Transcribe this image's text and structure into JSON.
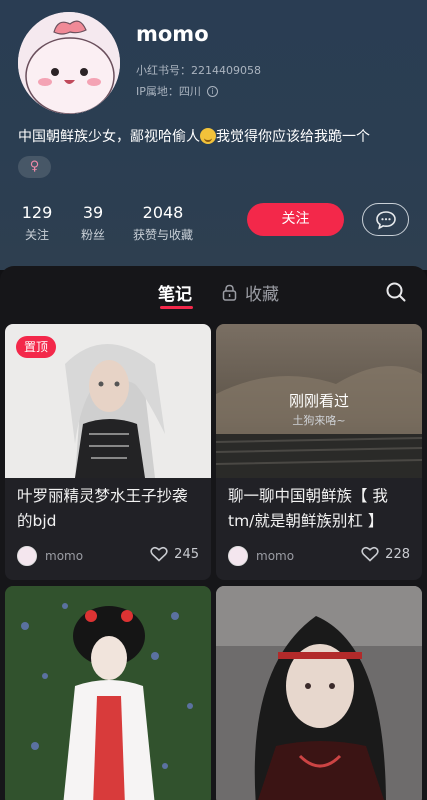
{
  "profile": {
    "nickname": "momo",
    "red_id": "小红书号：2214409058",
    "ip": "IP属地：四川",
    "bio_before": "中国朝鲜族少女，鄙视哈偷人",
    "bio_after": "我觉得你应该给我跪一个",
    "gender_symbol": "♀"
  },
  "stats": [
    {
      "value": "129",
      "label": "关注"
    },
    {
      "value": "39",
      "label": "粉丝"
    },
    {
      "value": "2048",
      "label": "获赞与收藏"
    }
  ],
  "actions": {
    "follow_label": "关注"
  },
  "tabs": {
    "notes": "笔记",
    "favorites": "收藏"
  },
  "notes": [
    {
      "title": "叶罗丽精灵梦水王子抄袭的bjd",
      "author": "momo",
      "likes": "245",
      "badge": "置顶"
    },
    {
      "title": "聊一聊中国朝鲜族【 我tm/就是朝鲜族别杠 】",
      "author": "momo",
      "likes": "228",
      "overlay_title": "刚刚看过",
      "overlay_sub": "土狗来咯~"
    },
    {
      "title": "",
      "author": "",
      "likes": ""
    },
    {
      "title": "",
      "author": "",
      "likes": ""
    }
  ],
  "colors": {
    "accent": "#f3284a",
    "header_bg": "#2b3e52",
    "content_bg": "#161619",
    "card_bg": "#212126"
  }
}
